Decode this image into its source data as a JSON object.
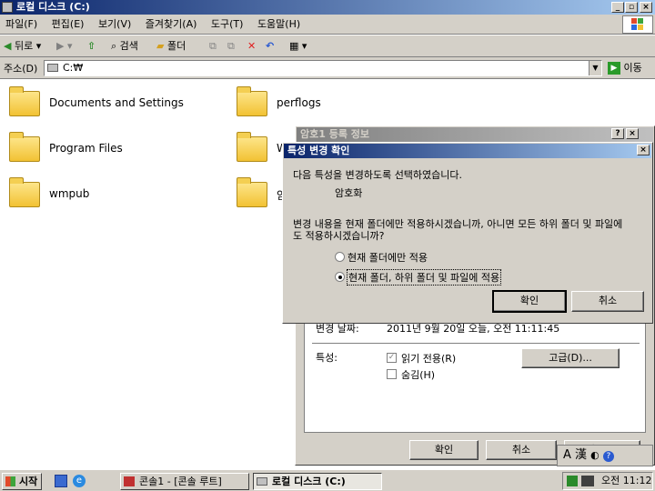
{
  "window": {
    "title": "로컬 디스크 (C:)"
  },
  "menu": [
    "파일(F)",
    "편집(E)",
    "보기(V)",
    "즐겨찾기(A)",
    "도구(T)",
    "도움말(H)"
  ],
  "toolbar": {
    "back": "뒤로",
    "search": "검색",
    "folders": "폴더"
  },
  "address": {
    "label": "주소(D)",
    "value": "C:₩",
    "go": "이동"
  },
  "folders": [
    "Documents and Settings",
    "perflogs",
    "Program Files",
    "W",
    "wmpub",
    "암"
  ],
  "bg_dialog": {
    "title": "암호1 등록 정보",
    "changed_label": "변경 날짜:",
    "changed_value": "2011년 9월 20일 오늘, 오전 11:11:45",
    "attributes_label": "특성:",
    "readonly_label": "읽기 전용(R)",
    "hidden_label": "숨김(H)",
    "advanced_label": "고급(D)...",
    "ok_label": "확인",
    "cancel_label": "취소",
    "apply_label": "적용(A)"
  },
  "confirm_dialog": {
    "title": "특성 변경 확인",
    "line1": "다음 특성을 변경하도록 선택하였습니다.",
    "attribute": "암호화",
    "question": "변경 내용을 현재 폴더에만 적용하시겠습니까, 아니면 모든 하위 폴더 및 파일에도 적용하시겠습니까?",
    "option1": "현재 폴더에만 적용",
    "option2": "현재 폴더, 하위 폴더 및 파일에 적용",
    "selected": "option2",
    "ok_label": "확인",
    "cancel_label": "취소"
  },
  "taskbar": {
    "start": "시작",
    "task1": "콘솔1 - [콘솔 루트]",
    "task2": "로컬 디스크 (C:)",
    "lang": "A 漢",
    "time": "오전 11:12"
  }
}
